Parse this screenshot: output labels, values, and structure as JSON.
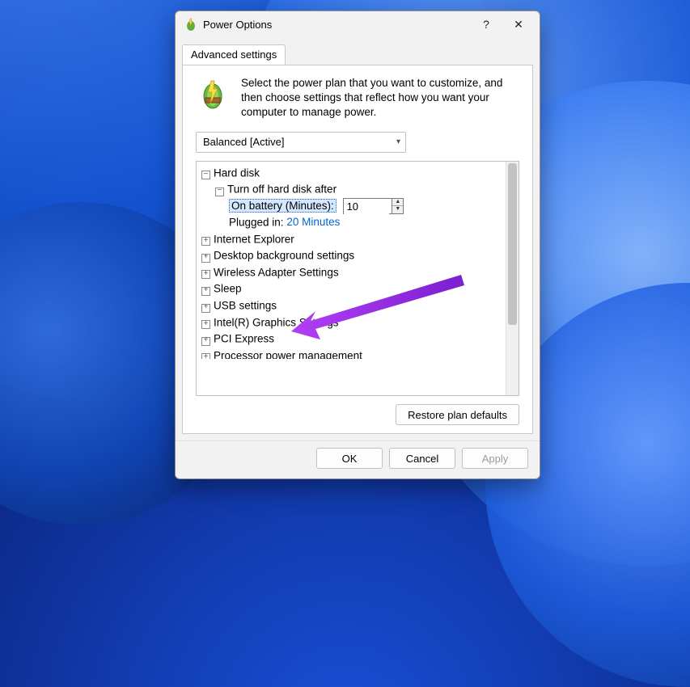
{
  "window": {
    "title": "Power Options",
    "help_label": "?",
    "close_label": "✕"
  },
  "tab": {
    "label": "Advanced settings"
  },
  "header": {
    "text": "Select the power plan that you want to customize, and then choose settings that reflect how you want your computer to manage power."
  },
  "plan": {
    "selected": "Balanced [Active]"
  },
  "tree": {
    "hard_disk": "Hard disk",
    "turn_off": "Turn off hard disk after",
    "on_battery_label": "On battery (Minutes):",
    "on_battery_value": "10",
    "plugged_in_label": "Plugged in:",
    "plugged_in_value": "20 Minutes",
    "ie": "Internet Explorer",
    "desktop_bg": "Desktop background settings",
    "wireless": "Wireless Adapter Settings",
    "sleep": "Sleep",
    "usb": "USB settings",
    "intel_gfx": "Intel(R) Graphics Settings",
    "pci": "PCI Express",
    "processor": "Processor power management"
  },
  "buttons": {
    "restore": "Restore plan defaults",
    "ok": "OK",
    "cancel": "Cancel",
    "apply": "Apply"
  }
}
